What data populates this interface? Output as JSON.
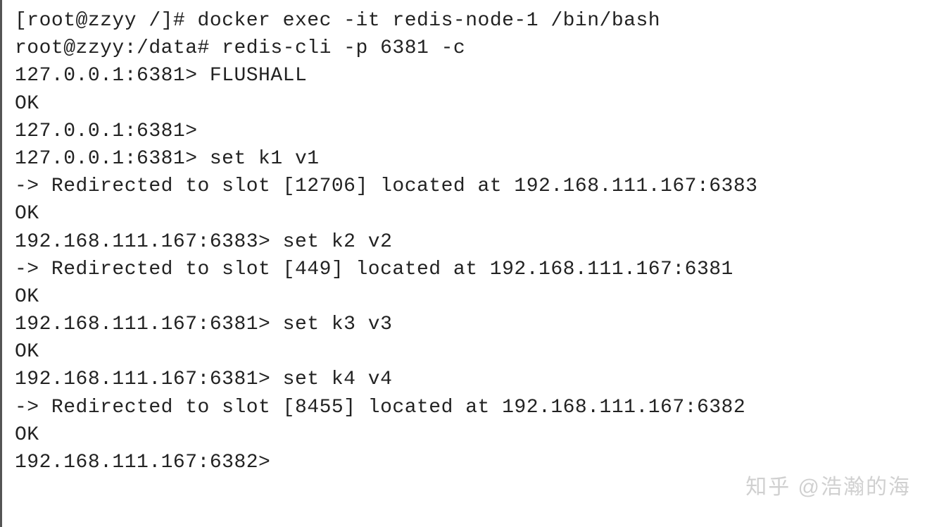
{
  "shell": {
    "host_prompt": "[root@zzyy /]# ",
    "docker_cmd": "docker exec -it redis-node-1 /bin/bash",
    "container_prompt": "root@zzyy:/data# ",
    "redis_cli_cmd": "redis-cli -p 6381 -c"
  },
  "cli": {
    "p127": "127.0.0.1:6381> ",
    "p167_6383": "192.168.111.167:6383> ",
    "p167_6381": "192.168.111.167:6381> ",
    "p167_6382": "192.168.111.167:6382> ",
    "flushall": "FLUSHALL",
    "ok": "OK",
    "empty": "",
    "set_k1": "set k1 v1",
    "set_k2": "set k2 v2",
    "set_k3": "set k3 v3",
    "set_k4": "set k4 v4",
    "redirect_12706": "-> Redirected to slot [12706] located at 192.168.111.167:6383",
    "redirect_449": "-> Redirected to slot [449] located at 192.168.111.167:6381",
    "redirect_8455": "-> Redirected to slot [8455] located at 192.168.111.167:6382"
  },
  "watermark": "知乎 @浩瀚的海"
}
